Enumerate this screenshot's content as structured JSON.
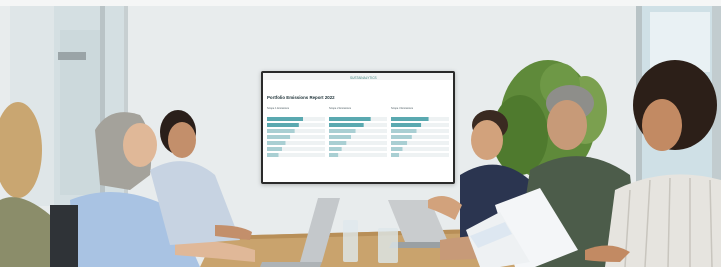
{
  "colors": {
    "wall": "#e9ecec",
    "window": "#cfe2e8",
    "tv_frame": "#2a2a2a",
    "screen_bg": "#ffffff",
    "bar_teal": "#5aa9b0",
    "bar_light": "#a9cfd3",
    "table": "#c8a06a"
  },
  "screen": {
    "title": "Portfolio Emissions Report 2022",
    "brand": "SUSTAINALYTICS",
    "panel_labels": [
      "Scope 1 Emissions",
      "Scope 2 Emissions",
      "Scope 3 Emissions"
    ],
    "panel_bars": [
      [
        0.62,
        0.55,
        0.48,
        0.4,
        0.32,
        0.26,
        0.2
      ],
      [
        0.72,
        0.6,
        0.46,
        0.38,
        0.3,
        0.22,
        0.16
      ],
      [
        0.65,
        0.52,
        0.44,
        0.36,
        0.28,
        0.2,
        0.14
      ]
    ]
  }
}
